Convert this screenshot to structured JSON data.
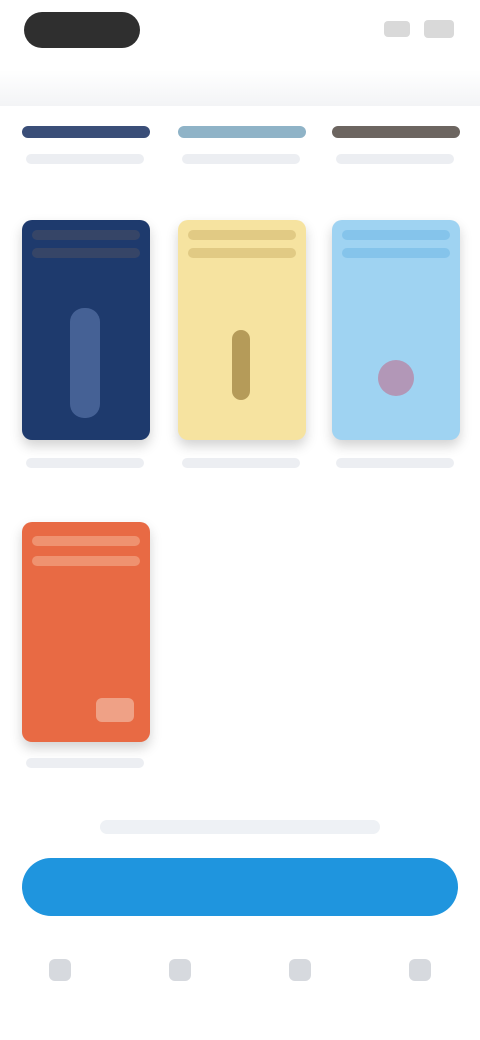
{
  "status_bar": {
    "icons": [
      "signal-icon",
      "battery-icon"
    ]
  },
  "library": {
    "shelf_titles": [
      "",
      "",
      ""
    ],
    "books": [
      {
        "cover_color": "#1e3a6d",
        "accent": "#3f4a66",
        "caption": ""
      },
      {
        "cover_color": "#f6e3a0",
        "accent": "#d9c27b",
        "caption": ""
      },
      {
        "cover_color": "#9fd3f2",
        "accent": "#7cbfe8",
        "caption": ""
      },
      {
        "cover_color": "#e86a44",
        "accent": "#f1a07f",
        "caption": ""
      }
    ]
  },
  "primary_action": {
    "label": "",
    "color": "#1f95de"
  },
  "bottom_nav": {
    "items": [
      "home-icon",
      "search-icon",
      "library-icon",
      "profile-icon"
    ]
  }
}
